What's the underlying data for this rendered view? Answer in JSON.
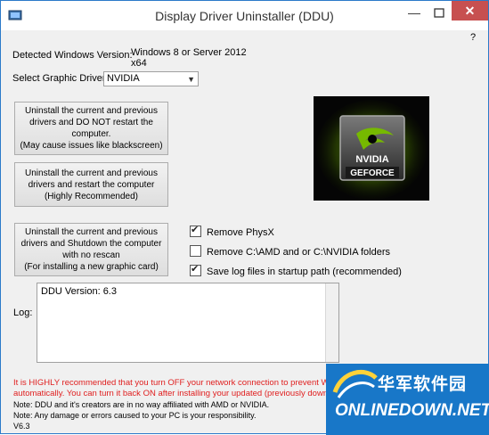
{
  "window": {
    "title": "Display Driver Uninstaller (DDU)",
    "minimize": "—",
    "close": "✕",
    "help": "?"
  },
  "os": {
    "label": "Detected Windows Version:",
    "value_line1": "Windows 8 or Server 2012",
    "value_line2": "x64"
  },
  "driver": {
    "label": "Select Graphic Driver:",
    "selected": "NVIDIA"
  },
  "buttons": {
    "clean_no_restart": "Uninstall the current and previous\ndrivers and DO NOT restart the\ncomputer.\n(May cause issues like blackscreen)",
    "clean_restart": "Uninstall the current and previous\ndrivers and restart the computer\n(Highly Recommended)",
    "clean_shutdown": "Uninstall the current and previous\ndrivers and Shutdown the computer\nwith no rescan\n(For installing a new graphic card)"
  },
  "logo": {
    "brand": "NVIDIA",
    "sub": "GEFORCE"
  },
  "options": {
    "physx": {
      "label": "Remove PhysX",
      "checked": true
    },
    "folders": {
      "label": "Remove C:\\AMD and or C:\\NVIDIA folders",
      "checked": false
    },
    "savelog": {
      "label": "Save log files in startup path (recommended)",
      "checked": true
    }
  },
  "log": {
    "label": "Log:",
    "content": "DDU Version: 6.3"
  },
  "warnings": {
    "line1": "It is HIGHLY recommended that you turn OFF your network connection to prevent W",
    "line2": "automatically. You can turn it back ON after installing your updated (previously down"
  },
  "notes": {
    "note1": "Note: DDU and it's creators are in no way affiliated with AMD or NVIDIA.",
    "note2": "Note: Any damage or errors caused to your PC is  your responsibility.",
    "version": "V6.3"
  },
  "watermark": {
    "cn": "华军软件园",
    "en": "ONLINEDOWN.NET"
  },
  "colors": {
    "close_bg": "#c75050",
    "warning": "#e02020",
    "nvidia_green": "#76b900",
    "watermark_bg": "#1877c8"
  }
}
